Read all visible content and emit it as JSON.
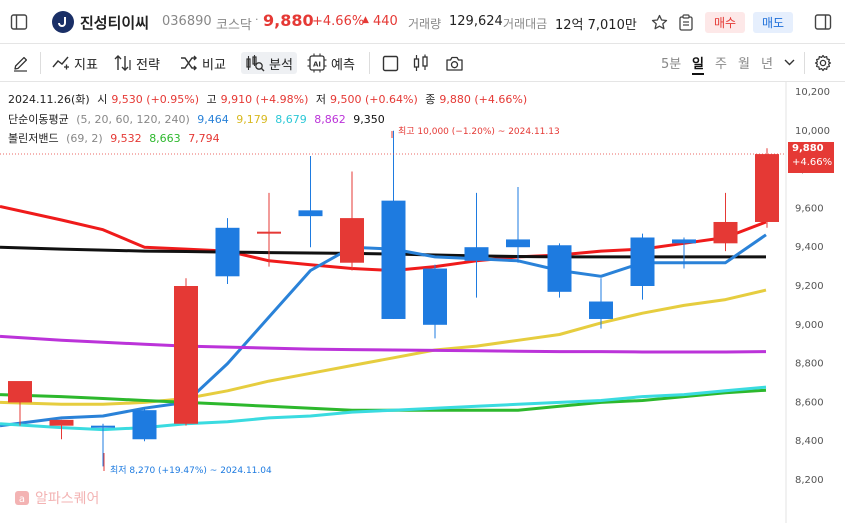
{
  "header": {
    "stock_name": "진성티이씨",
    "code": "036890",
    "market": "코스닥",
    "price": "9,880",
    "change_pct": "+4.66%",
    "change_abs": "440",
    "volume_label": "거래량",
    "volume": "129,624",
    "amount_label": "거래대금",
    "amount": "12억 7,010만",
    "sell_label": "매수",
    "buy_label": "매도"
  },
  "toolbar": {
    "indicator": "지표",
    "strategy": "전략",
    "compare": "비교",
    "analysis": "분석",
    "forecast": "예측",
    "periods": [
      "5분",
      "일",
      "주",
      "월",
      "년"
    ],
    "selected_period": "일"
  },
  "legend": {
    "ohlc": {
      "date": "2024.11.26(화)",
      "open_label": "시",
      "open": "9,530 (+0.95%)",
      "high_label": "고",
      "high": "9,910 (+4.98%)",
      "low_label": "저",
      "low": "9,500 (+0.64%)",
      "close_label": "종",
      "close": "9,880 (+4.66%)"
    },
    "sma": {
      "label": "단순이동평균",
      "params": "(5, 20, 60, 120, 240)",
      "v5": "9,464",
      "v20": "9,179",
      "v60": "8,679",
      "v120": "8,862",
      "v240": "9,350"
    },
    "bb": {
      "label": "볼린저밴드",
      "params": "(69, 2)",
      "upper": "9,532",
      "mid": "8,663",
      "lower": "7,794"
    }
  },
  "annotations": {
    "high": "최고 10,000 (−1.20%) ~ 2024.11.13",
    "low": "최저 8,270 (+19.47%) ~ 2024.11.04"
  },
  "price_tag": {
    "price": "9,880",
    "pct": "+4.66%"
  },
  "watermark": "알파스퀘어",
  "colors": {
    "up": "#e53935",
    "down": "#1e7be0",
    "ma5": "#2a82d8",
    "ma20": "#e6cd3f",
    "ma60": "#3adbe0",
    "ma120": "#bb33d9",
    "ma240": "#111111",
    "bb_upper": "#ef1b1b",
    "bb_mid": "#2db82d"
  },
  "chart_data": {
    "type": "candlestick",
    "y_ticks": [
      10200,
      10000,
      9800,
      9600,
      9400,
      9200,
      9000,
      8800,
      8600,
      8400,
      8200
    ],
    "ylim": [
      8130,
      10210
    ],
    "candles": [
      {
        "o": 8600,
        "h": 8700,
        "l": 8480,
        "c": 8710
      },
      {
        "o": 8480,
        "h": 8510,
        "l": 8410,
        "c": 8510
      },
      {
        "o": 8480,
        "h": 8490,
        "l": 8270,
        "c": 8470
      },
      {
        "o": 8560,
        "h": 8570,
        "l": 8400,
        "c": 8410
      },
      {
        "o": 8490,
        "h": 9240,
        "l": 8480,
        "c": 9200
      },
      {
        "o": 9500,
        "h": 9550,
        "l": 9210,
        "c": 9250
      },
      {
        "o": 9470,
        "h": 9680,
        "l": 9300,
        "c": 9480
      },
      {
        "o": 9590,
        "h": 9870,
        "l": 9400,
        "c": 9560
      },
      {
        "o": 9320,
        "h": 9790,
        "l": 9280,
        "c": 9550
      },
      {
        "o": 9640,
        "h": 10000,
        "l": 9030,
        "c": 9030
      },
      {
        "o": 9290,
        "h": 9310,
        "l": 8930,
        "c": 9000
      },
      {
        "o": 9400,
        "h": 9680,
        "l": 9140,
        "c": 9330
      },
      {
        "o": 9440,
        "h": 9710,
        "l": 9320,
        "c": 9400
      },
      {
        "o": 9410,
        "h": 9420,
        "l": 9140,
        "c": 9170
      },
      {
        "o": 9120,
        "h": 9240,
        "l": 8980,
        "c": 9030
      },
      {
        "o": 9450,
        "h": 9470,
        "l": 9130,
        "c": 9200
      },
      {
        "o": 9440,
        "h": 9450,
        "l": 9290,
        "c": 9420
      },
      {
        "o": 9420,
        "h": 9680,
        "l": 9380,
        "c": 9530
      },
      {
        "o": 9530,
        "h": 9910,
        "l": 9500,
        "c": 9880
      }
    ],
    "lines": {
      "bb_upper": [
        9610,
        9540,
        9490,
        9400,
        9390,
        9380,
        9330,
        9310,
        9290,
        9280,
        9300,
        9330,
        9350,
        9360,
        9380,
        9390,
        9420,
        9450,
        9530
      ],
      "sma240": [
        9400,
        9390,
        9385,
        9380,
        9378,
        9375,
        9372,
        9370,
        9368,
        9365,
        9360,
        9355,
        9352,
        9350,
        9350,
        9350,
        9350,
        9350,
        9350
      ],
      "sma5": [
        8480,
        8520,
        8530,
        8570,
        8600,
        8800,
        9040,
        9280,
        9400,
        9390,
        9350,
        9340,
        9330,
        9280,
        9250,
        9320,
        9320,
        9320,
        9464
      ],
      "sma20": [
        8600,
        8590,
        8590,
        8600,
        8620,
        8660,
        8710,
        8750,
        8790,
        8830,
        8870,
        8890,
        8920,
        8950,
        9010,
        9060,
        9100,
        9130,
        9179
      ],
      "sma120": [
        8940,
        8920,
        8910,
        8900,
        8890,
        8885,
        8880,
        8875,
        8872,
        8870,
        8868,
        8866,
        8864,
        8862,
        8862,
        8860,
        8860,
        8860,
        8862
      ],
      "bb_mid": [
        8640,
        8630,
        8620,
        8610,
        8600,
        8590,
        8580,
        8570,
        8560,
        8560,
        8560,
        8560,
        8560,
        8580,
        8600,
        8610,
        8630,
        8650,
        8663
      ],
      "sma60": [
        8490,
        8470,
        8460,
        8470,
        8490,
        8500,
        8520,
        8530,
        8550,
        8560,
        8570,
        8580,
        8590,
        8600,
        8610,
        8630,
        8640,
        8660,
        8679
      ]
    }
  }
}
